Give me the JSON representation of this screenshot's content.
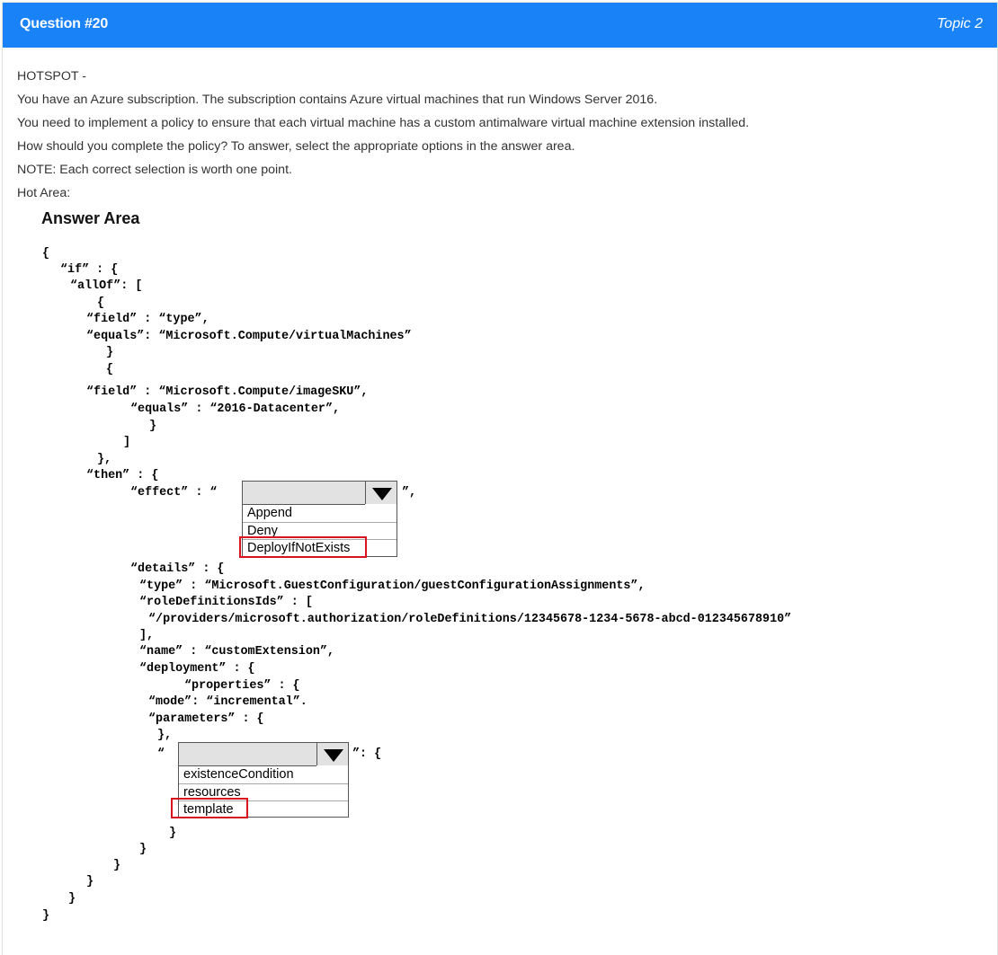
{
  "header": {
    "title": "Question #20",
    "topic": "Topic 2"
  },
  "question": {
    "lines": [
      "HOTSPOT -",
      "You have an Azure subscription. The subscription contains Azure virtual machines that run Windows Server 2016.",
      "You need to implement a policy to ensure that each virtual machine has a custom antimalware virtual machine extension installed.",
      "How should you complete the policy? To answer, select the appropriate options in the answer area.",
      "NOTE: Each correct selection is worth one point.",
      "Hot Area:"
    ]
  },
  "answer_area": {
    "title": "Answer Area",
    "code": {
      "l1": "{",
      "l2": "“if” : {",
      "l3": "“allOf”: [",
      "l4": "{",
      "l5": "“field” : “type”,",
      "l6": "“equals”: “Microsoft.Compute/virtualMachines”",
      "l7": "}",
      "l8": "{",
      "l9": "“field” : “Microsoft.Compute/imageSKU”,",
      "l10": "“equals” : “2016-Datacenter”,",
      "l11": "}",
      "l12": "]",
      "l13": "},",
      "l14": "“then” : {",
      "l15a": "“effect” : “",
      "l15b": "”,",
      "l16": "“details” : {",
      "l17": "“type” : “Microsoft.GuestConfiguration/guestConfigurationAssignments”,",
      "l18": "“roleDefinitionsIds” : [",
      "l19": "“/providers/microsoft.authorization/roleDefinitions/12345678-1234-5678-abcd-012345678910”",
      "l20": "],",
      "l21": "“name” : “customExtension”,",
      "l22": "“deployment” : {",
      "l23": "“properties” : {",
      "l24": "“mode”: “incremental”.",
      "l25": "“parameters” : {",
      "l26": "},",
      "l27a": "“",
      "l27b": "”: {",
      "l28": "}",
      "l29": "}",
      "l30": "}",
      "l31": "}",
      "l32": "}",
      "l33": "}"
    },
    "effect_dropdown": {
      "options": [
        "Append",
        "Deny",
        "DeployIfNotExists"
      ],
      "selected": "DeployIfNotExists"
    },
    "key_dropdown": {
      "options": [
        "existenceCondition",
        "resources",
        "template"
      ],
      "selected": "template"
    }
  },
  "colors": {
    "header_bg": "#1a82f7",
    "highlight": "#d9141c"
  }
}
